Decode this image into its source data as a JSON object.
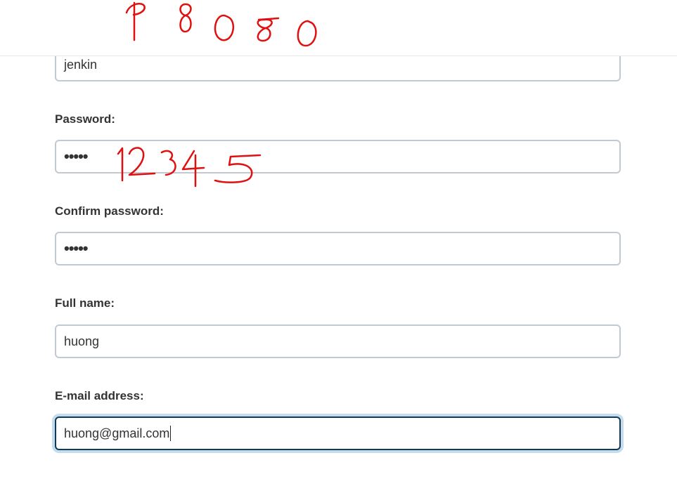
{
  "form": {
    "username": {
      "value": "jenkin"
    },
    "password": {
      "label": "Password:",
      "value": "•••••"
    },
    "confirm_password": {
      "label": "Confirm password:",
      "value": "•••••"
    },
    "full_name": {
      "label": "Full name:",
      "value": "huong"
    },
    "email": {
      "label": "E-mail address:",
      "value": "huong@gmail.com"
    }
  },
  "annotations": {
    "port_note": "P 8080",
    "password_note": "12345",
    "ink_color": "#e01010"
  },
  "colors": {
    "input_border": "#c2c9d1",
    "focus_border": "#0f3a58",
    "focus_ring": "#c5dced"
  }
}
